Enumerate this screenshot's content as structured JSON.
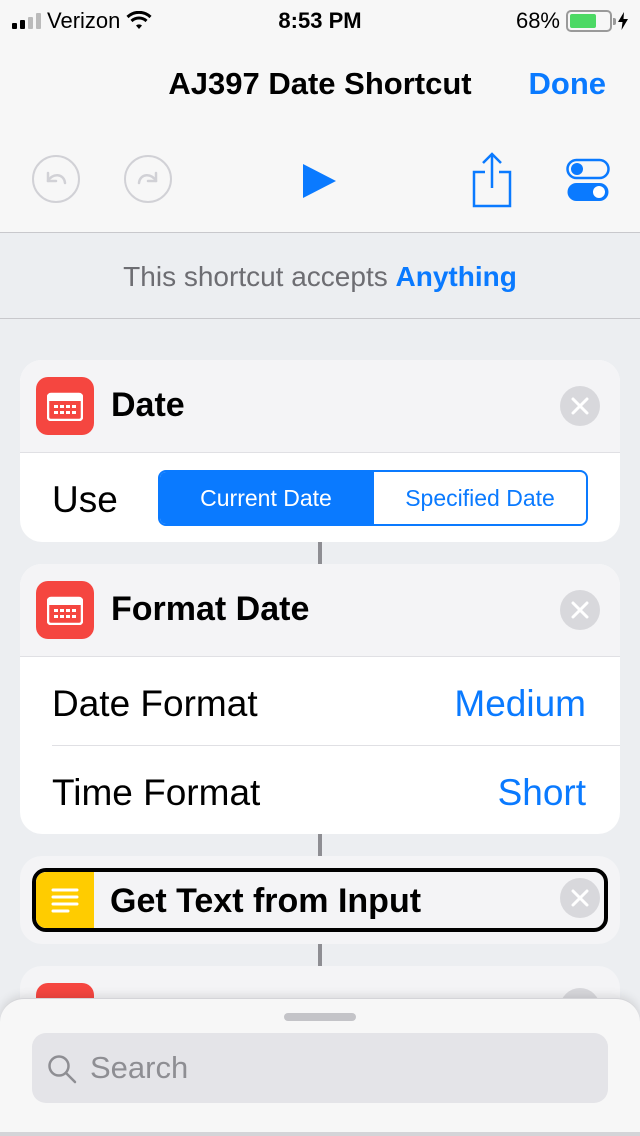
{
  "status_bar": {
    "carrier": "Verizon",
    "time": "8:53 PM",
    "battery_percent": "68%",
    "battery_level": 0.68
  },
  "nav": {
    "title": "AJ397 Date Shortcut",
    "done_label": "Done"
  },
  "toolbar": {
    "icons": [
      "undo-icon",
      "redo-icon",
      "play-icon",
      "share-icon",
      "settings-toggles-icon"
    ]
  },
  "accepts": {
    "prefix": "This shortcut accepts",
    "value": "Anything"
  },
  "actions": [
    {
      "title": "Date",
      "icon": "calendar-icon",
      "use_label": "Use",
      "segments": [
        "Current Date",
        "Specified Date"
      ],
      "selected_segment": "Current Date"
    },
    {
      "title": "Format Date",
      "icon": "calendar-icon",
      "rows": [
        {
          "label": "Date Format",
          "value": "Medium"
        },
        {
          "label": "Time Format",
          "value": "Short"
        }
      ]
    },
    {
      "title": "Get Text from Input",
      "icon": "text-lines-icon"
    }
  ],
  "search": {
    "placeholder": "Search"
  },
  "colors": {
    "accent": "#0a7aff",
    "calendar_icon": "#f54640",
    "text_icon": "#ffcc00",
    "battery": "#4cd964"
  }
}
